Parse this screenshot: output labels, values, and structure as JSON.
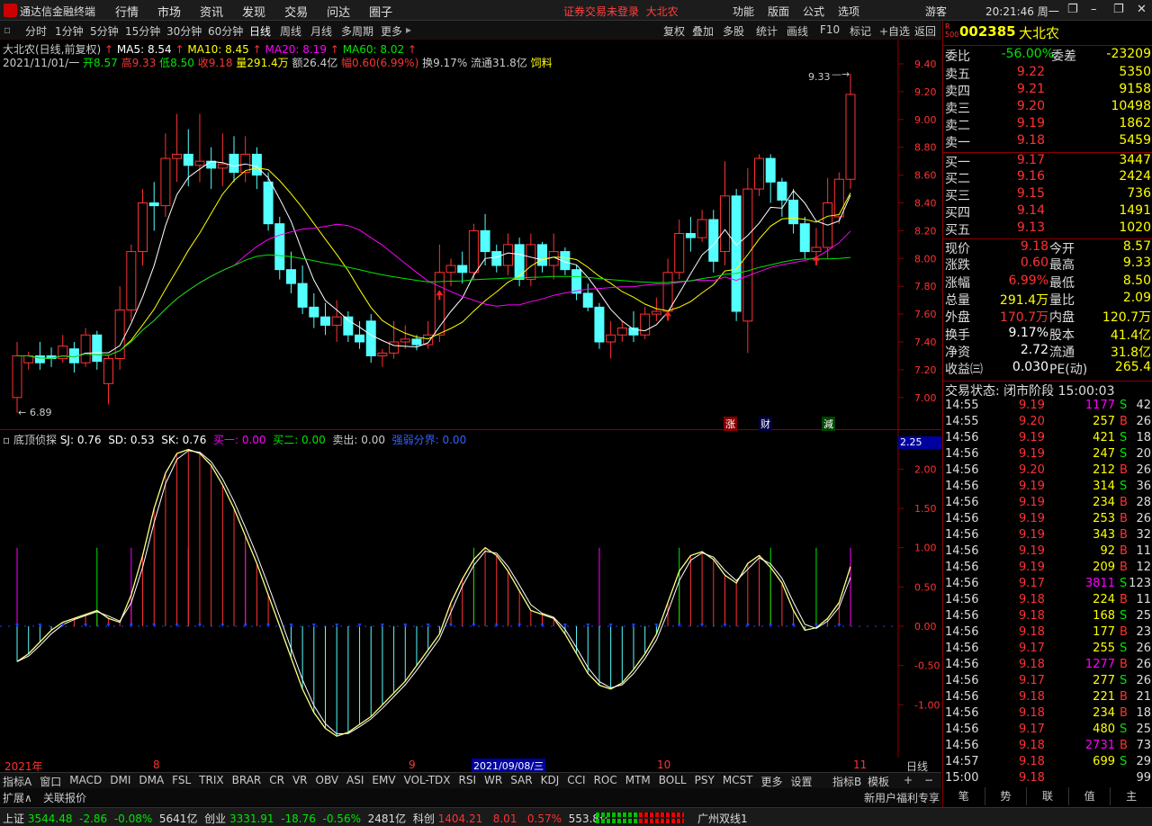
{
  "app": {
    "title": "通达信金融终端",
    "warning": "证券交易未登录",
    "stock_short": "大北农",
    "guest": "游客",
    "clock": "20:21:46 周一"
  },
  "menu": [
    "行情",
    "市场",
    "资讯",
    "发现",
    "交易",
    "问达",
    "圈子"
  ],
  "right_menu": [
    "功能",
    "版面",
    "公式",
    "选项"
  ],
  "window_controls": [
    "❐",
    "–",
    "❐",
    "✕"
  ],
  "periods": [
    "分时",
    "1分钟",
    "5分钟",
    "15分钟",
    "30分钟",
    "60分钟",
    "日线",
    "周线",
    "月线",
    "多周期",
    "更多"
  ],
  "selected_period": "日线",
  "tools": [
    "复权",
    "叠加",
    "多股",
    "统计",
    "画线",
    "F10",
    "标记",
    "+自选",
    "返回"
  ],
  "main_chart": {
    "name": "大北农(日线,前复权)",
    "ma5": "MA5: 8.54",
    "ma10": "MA10: 8.45",
    "ma20": "MA20: 8.19",
    "ma60": "MA60: 8.02",
    "date": "2021/11/01/一",
    "open": "开8.57",
    "high": "高9.33",
    "low": "低8.50",
    "close": "收9.18",
    "volume": "量291.4万",
    "amount": "额26.4亿",
    "change": "幅0.60(6.99%)",
    "turnover": "换9.17%",
    "float": "流通31.8亿",
    "industry": "饲料",
    "high_mark": "9.33",
    "low_mark": "6.89",
    "price_ticks": [
      "9.40",
      "9.20",
      "9.00",
      "8.80",
      "8.60",
      "8.40",
      "8.20",
      "8.00",
      "7.80",
      "7.60",
      "7.40",
      "7.20",
      "7.00"
    ],
    "events": [
      "涨",
      "财",
      "減"
    ],
    "colors": {
      "up": "#ff3232",
      "down": "#54ffff",
      "ma5": "#ffffff",
      "ma10": "#ffff00",
      "ma20": "#ff00ff",
      "ma60": "#00e600"
    }
  },
  "sub_chart": {
    "name": "底顶侦探",
    "sj": "SJ: 0.76",
    "sd": "SD: 0.53",
    "sk": "SK: 0.76",
    "buy1": "买一: 0.00",
    "buy2": "买二: 0.00",
    "sell": "卖出: 0.00",
    "divide": "强弱分界: 0.00",
    "current": "2.25",
    "ticks": [
      "2.00",
      "1.50",
      "1.00",
      "0.50",
      "0.00",
      "-0.50",
      "-1.00"
    ]
  },
  "x_axis": {
    "labels": [
      "2021年",
      "8",
      "9",
      "2021/09/08/三",
      "10",
      "11"
    ],
    "period": "日线"
  },
  "indicator_tabs": [
    "指标A",
    "窗口",
    "MACD",
    "DMI",
    "DMA",
    "FSL",
    "TRIX",
    "BRAR",
    "CR",
    "VR",
    "OBV",
    "ASI",
    "EMV",
    "VOL-TDX",
    "RSI",
    "WR",
    "SAR",
    "KDJ",
    "CCI",
    "ROC",
    "MTM",
    "BOLL",
    "PSY",
    "MCST",
    "更多",
    "设置"
  ],
  "indicator_right": [
    "指标B",
    "模板",
    "+",
    "−"
  ],
  "ext_tabs": [
    "扩展∧",
    "关联报价"
  ],
  "quote": {
    "code": "002385",
    "name": "大北农",
    "weibi_label": "委比",
    "weibi": "-56.00%",
    "weicha_label": "委差",
    "weicha": "-23209",
    "asks": [
      {
        "label": "卖五",
        "price": "9.22",
        "vol": "5350"
      },
      {
        "label": "卖四",
        "price": "9.21",
        "vol": "9158"
      },
      {
        "label": "卖三",
        "price": "9.20",
        "vol": "10498"
      },
      {
        "label": "卖二",
        "price": "9.19",
        "vol": "1862"
      },
      {
        "label": "卖一",
        "price": "9.18",
        "vol": "5459"
      }
    ],
    "bids": [
      {
        "label": "买一",
        "price": "9.17",
        "vol": "3447"
      },
      {
        "label": "买二",
        "price": "9.16",
        "vol": "2424"
      },
      {
        "label": "买三",
        "price": "9.15",
        "vol": "736"
      },
      {
        "label": "买四",
        "price": "9.14",
        "vol": "1491"
      },
      {
        "label": "买五",
        "price": "9.13",
        "vol": "1020"
      }
    ],
    "stats": [
      {
        "l1": "现价",
        "v1": "9.18",
        "c1": "red",
        "l2": "今开",
        "v2": "8.57",
        "c2": "green"
      },
      {
        "l1": "涨跌",
        "v1": "0.60",
        "c1": "red",
        "l2": "最高",
        "v2": "9.33",
        "c2": "red"
      },
      {
        "l1": "涨幅",
        "v1": "6.99%",
        "c1": "red",
        "l2": "最低",
        "v2": "8.50",
        "c2": "green"
      },
      {
        "l1": "总量",
        "v1": "291.4万",
        "c1": "yellow",
        "l2": "量比",
        "v2": "2.09",
        "c2": "red"
      },
      {
        "l1": "外盘",
        "v1": "170.7万",
        "c1": "red",
        "l2": "内盘",
        "v2": "120.7万",
        "c2": "green"
      },
      {
        "l1": "换手",
        "v1": "9.17%",
        "c1": "white",
        "l2": "股本",
        "v2": "41.4亿",
        "c2": "white"
      },
      {
        "l1": "净资",
        "v1": "2.72",
        "c1": "white",
        "l2": "流通",
        "v2": "31.8亿",
        "c2": "white"
      },
      {
        "l1": "收益㈢",
        "v1": "0.030",
        "c1": "white",
        "l2": "PE(动)",
        "v2": "265.4",
        "c2": "white"
      }
    ],
    "trade_state": "交易状态: 闭市阶段 15:00:03",
    "ticks": [
      [
        "14:55",
        "9.19",
        "1177",
        "S",
        "42"
      ],
      [
        "14:55",
        "9.20",
        "257",
        "B",
        "26"
      ],
      [
        "14:56",
        "9.19",
        "421",
        "S",
        "18"
      ],
      [
        "14:56",
        "9.19",
        "247",
        "S",
        "20"
      ],
      [
        "14:56",
        "9.20",
        "212",
        "B",
        "26"
      ],
      [
        "14:56",
        "9.19",
        "314",
        "S",
        "36"
      ],
      [
        "14:56",
        "9.19",
        "234",
        "B",
        "28"
      ],
      [
        "14:56",
        "9.19",
        "253",
        "B",
        "26"
      ],
      [
        "14:56",
        "9.19",
        "343",
        "B",
        "32"
      ],
      [
        "14:56",
        "9.19",
        "92",
        "B",
        "11"
      ],
      [
        "14:56",
        "9.19",
        "209",
        "B",
        "12"
      ],
      [
        "14:56",
        "9.17",
        "3811",
        "S",
        "123"
      ],
      [
        "14:56",
        "9.18",
        "224",
        "B",
        "11"
      ],
      [
        "14:56",
        "9.18",
        "168",
        "S",
        "25"
      ],
      [
        "14:56",
        "9.18",
        "177",
        "B",
        "23"
      ],
      [
        "14:56",
        "9.17",
        "255",
        "S",
        "26"
      ],
      [
        "14:56",
        "9.18",
        "1277",
        "B",
        "26"
      ],
      [
        "14:56",
        "9.17",
        "277",
        "S",
        "26"
      ],
      [
        "14:56",
        "9.18",
        "221",
        "B",
        "21"
      ],
      [
        "14:56",
        "9.18",
        "234",
        "B",
        "18"
      ],
      [
        "14:56",
        "9.17",
        "480",
        "S",
        "25"
      ],
      [
        "14:56",
        "9.18",
        "2731",
        "B",
        "73"
      ],
      [
        "14:57",
        "9.18",
        "699",
        "S",
        "29"
      ],
      [
        "15:00",
        "9.18",
        "",
        "",
        "99"
      ]
    ],
    "bottom_tabs": [
      "笔",
      "势",
      "联",
      "值",
      "主"
    ]
  },
  "status": {
    "sh_label": "上证",
    "sh_val": "3544.48",
    "sh_chg": "-2.86",
    "sh_pct": "-0.08%",
    "sh_amt": "5641亿",
    "cy_label": "创业",
    "cy_val": "3331.91",
    "cy_chg": "-18.76",
    "cy_pct": "-0.56%",
    "cy_amt": "2481亿",
    "kc_label": "科创",
    "kc_val": "1404.21",
    "kc_chg": "8.01",
    "kc_pct": "0.57%",
    "kc_amt": "553.8亿",
    "promo": "新用户福利专享",
    "broker": "广州双线1"
  }
}
